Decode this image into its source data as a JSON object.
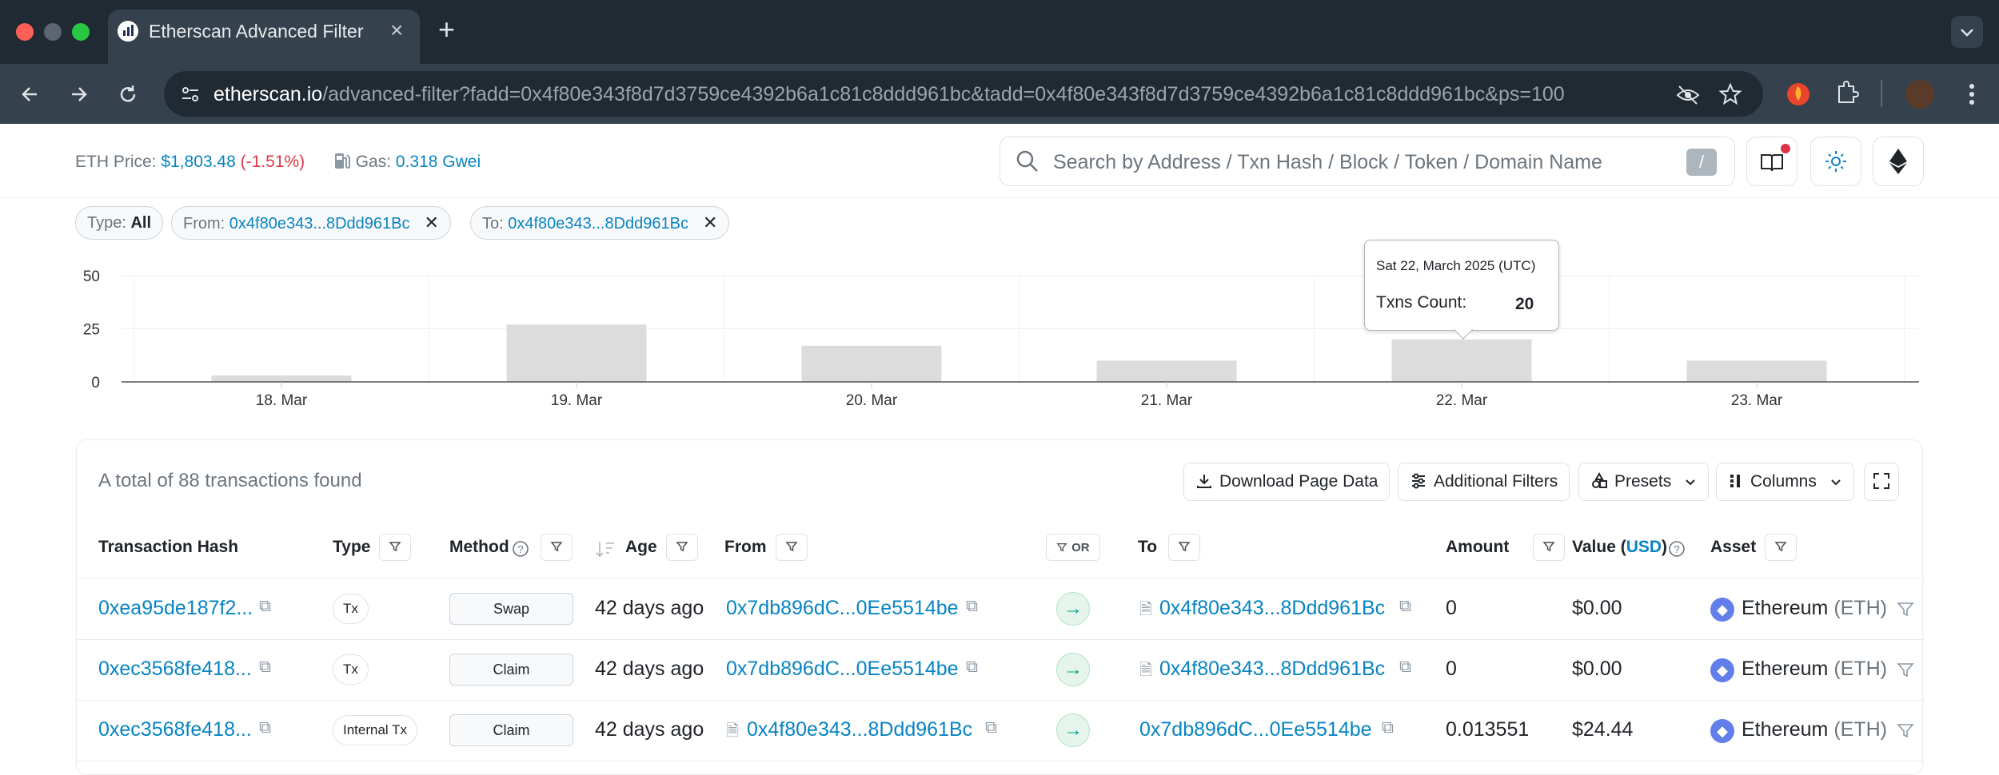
{
  "browser": {
    "tab_title": "Etherscan Advanced Filter",
    "url_domain": "etherscan.io",
    "url_path": "/advanced-filter?fadd=0x4f80e343f8d7d3759ce4392b6a1c81c8ddd961bc&tadd=0x4f80e343f8d7d3759ce4392b6a1c81c8ddd961bc&ps=100"
  },
  "header": {
    "eth_price_label": "ETH Price:",
    "eth_price": "$1,803.48",
    "eth_change": "(-1.51%)",
    "gas_label": "Gas:",
    "gas_value": "0.318 Gwei",
    "search_placeholder": "Search by Address / Txn Hash / Block / Token / Domain Name",
    "search_shortcut": "/"
  },
  "filters": {
    "type_label": "Type:",
    "type_value": "All",
    "from_label": "From:",
    "from_value": "0x4f80e343...8Ddd961Bc",
    "to_label": "To:",
    "to_value": "0x4f80e343...8Ddd961Bc"
  },
  "chart_data": {
    "type": "bar",
    "categories": [
      "18. Mar",
      "19. Mar",
      "20. Mar",
      "21. Mar",
      "22. Mar",
      "23. Mar"
    ],
    "values": [
      3,
      27,
      17,
      10,
      20,
      10
    ],
    "ylim": [
      0,
      50
    ],
    "yticks": [
      "50",
      "25",
      "0"
    ],
    "grid": true,
    "title": "",
    "xlabel": "",
    "ylabel": "",
    "bar_color": "#dcdcdc"
  },
  "tooltip": {
    "date": "Sat 22, March 2025 (UTC)",
    "label": "Txns Count:",
    "value": "20"
  },
  "table": {
    "total_text": "A total of 88 transactions found",
    "actions": {
      "download": "Download Page Data",
      "filters": "Additional Filters",
      "presets": "Presets",
      "columns": "Columns"
    },
    "headers": {
      "hash": "Transaction Hash",
      "type": "Type",
      "method": "Method",
      "age": "Age",
      "from": "From",
      "or": "OR",
      "to": "To",
      "amount": "Amount",
      "value_prefix": "Value (",
      "value_usd": "USD",
      "value_suffix": ")",
      "asset": "Asset"
    },
    "rows": [
      {
        "hash": "0xea95de187f2...",
        "type": "Tx",
        "method": "Swap",
        "age": "42 days ago",
        "from": "0x7db896dC...0Ee5514be",
        "to": "0x4f80e343...8Ddd961Bc",
        "amount": "0",
        "value": "$0.00",
        "asset": "Ethereum",
        "asset_sym": "(ETH)"
      },
      {
        "hash": "0xec3568fe418...",
        "type": "Tx",
        "method": "Claim",
        "age": "42 days ago",
        "from": "0x7db896dC...0Ee5514be",
        "to": "0x4f80e343...8Ddd961Bc",
        "amount": "0",
        "value": "$0.00",
        "asset": "Ethereum",
        "asset_sym": "(ETH)"
      },
      {
        "hash": "0xec3568fe418...",
        "type": "Internal Tx",
        "method": "Claim",
        "age": "42 days ago",
        "from": "0x4f80e343...8Ddd961Bc",
        "to": "0x7db896dC...0Ee5514be",
        "amount": "0.013551",
        "value": "$24.44",
        "asset": "Ethereum",
        "asset_sym": "(ETH)"
      }
    ]
  }
}
